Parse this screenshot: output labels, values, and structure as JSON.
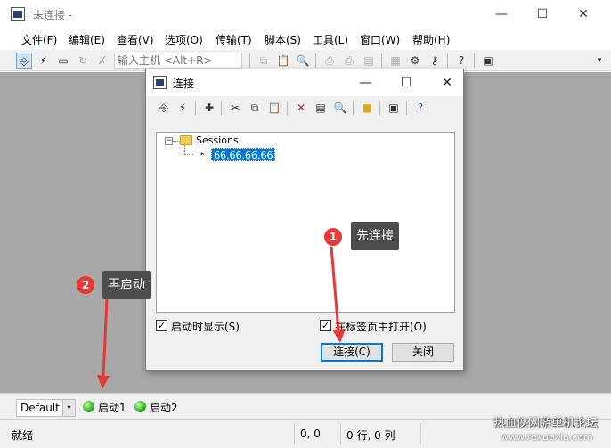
{
  "window": {
    "title": "未连接 -",
    "controls": {
      "minimize": "—",
      "maximize": "☐",
      "close": "✕"
    }
  },
  "menu": [
    "文件(F)",
    "编辑(E)",
    "查看(V)",
    "选项(O)",
    "传输(T)",
    "脚本(S)",
    "工具(L)",
    "窗口(W)",
    "帮助(H)"
  ],
  "toolbar": {
    "quick_connect_placeholder": "输入主机 <Alt+R>"
  },
  "dialog": {
    "title": "连接",
    "tree": {
      "expander": "−",
      "folder": "Sessions",
      "session": "66.66.66.66"
    },
    "show_on_startup": {
      "label": "启动时显示(S)",
      "checked": true
    },
    "open_in_tab": {
      "label": "在标签页中打开(O)",
      "checked": true
    },
    "connect_button": "连接(C)",
    "close_button": "关闭"
  },
  "annotations": [
    {
      "number": "1",
      "text": "先连接"
    },
    {
      "number": "2",
      "text": "再启动"
    }
  ],
  "button_bar": {
    "combo_value": "Default",
    "combo_arrow": "▾",
    "buttons": [
      "启动1",
      "启动2"
    ]
  },
  "status": {
    "ready": "就绪",
    "position": "0, 0",
    "rows_cols": "0 行, 0 列"
  },
  "watermark": {
    "line1": "热血侠网游单机论坛",
    "line2": "www.rexuexia.com"
  },
  "colors": {
    "accent": "#0078d7",
    "callout_bg": "#4c4c4c",
    "badge": "#e53935",
    "arrow": "#e53935",
    "workspace": "#a8a8a8"
  }
}
